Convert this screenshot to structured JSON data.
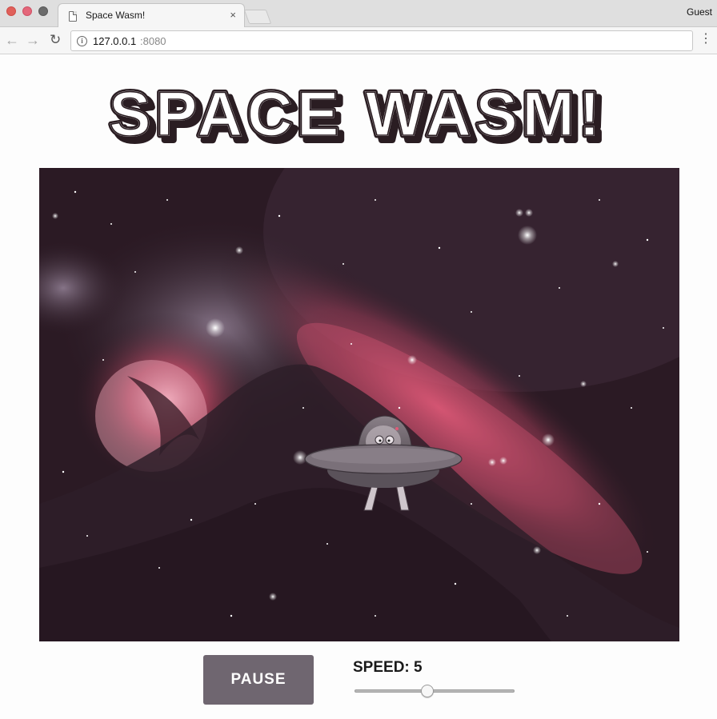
{
  "browser": {
    "tab_title": "Space Wasm!",
    "tab_close": "×",
    "profile": "Guest",
    "url_host": "127.0.0.1",
    "url_port": ":8080",
    "back_glyph": "←",
    "forward_glyph": "→",
    "reload_glyph": "↻",
    "menu_glyph": "⋮",
    "info_glyph": "i"
  },
  "page": {
    "title": "SPACE WASM!"
  },
  "game": {
    "scene": "nebula",
    "sprite": "ufo-with-alien"
  },
  "controls": {
    "pause_label": "PAUSE",
    "speed_label": "SPEED: 5",
    "speed_value": 5,
    "speed_fraction": 0.45
  },
  "colors": {
    "button_bg": "#6f6670",
    "title_fill": "#ffffff",
    "title_outline": "#2a1d22",
    "nebula_pink": "#e05a78"
  }
}
